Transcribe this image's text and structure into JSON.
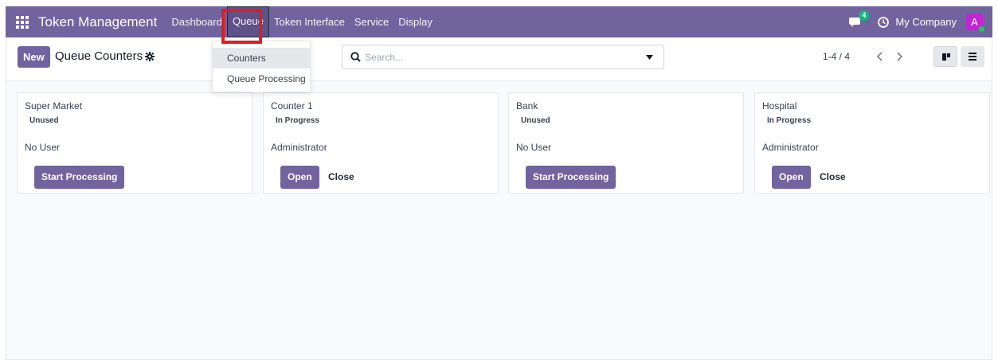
{
  "colors": {
    "brand": "#71639e",
    "annotation": "#e11d1d",
    "badge": "#10b981",
    "avatar": "#c026d3"
  },
  "navbar": {
    "apps_icon": "grid-icon",
    "title": "Token Management",
    "menu": [
      "Dashboard",
      "Queue",
      "Token Interface",
      "Service",
      "Display"
    ],
    "chat_badge": "4",
    "company": "My Company",
    "avatar_letter": "A"
  },
  "queue_dropdown": {
    "items": [
      "Counters",
      "Queue Processing"
    ]
  },
  "control_panel": {
    "new_label": "New",
    "title": "Queue Counters",
    "search_placeholder": "Search...",
    "pager": "1-4 / 4"
  },
  "cards": [
    {
      "name": "Super Market",
      "state": "Unused",
      "user": "No User",
      "primary": "Start Processing",
      "secondary": ""
    },
    {
      "name": "Counter 1",
      "state": "In Progress",
      "user": "Administrator",
      "primary": "Open",
      "secondary": "Close"
    },
    {
      "name": "Bank",
      "state": "Unused",
      "user": "No User",
      "primary": "Start Processing",
      "secondary": ""
    },
    {
      "name": "Hospital",
      "state": "In Progress",
      "user": "Administrator",
      "primary": "Open",
      "secondary": "Close"
    }
  ]
}
